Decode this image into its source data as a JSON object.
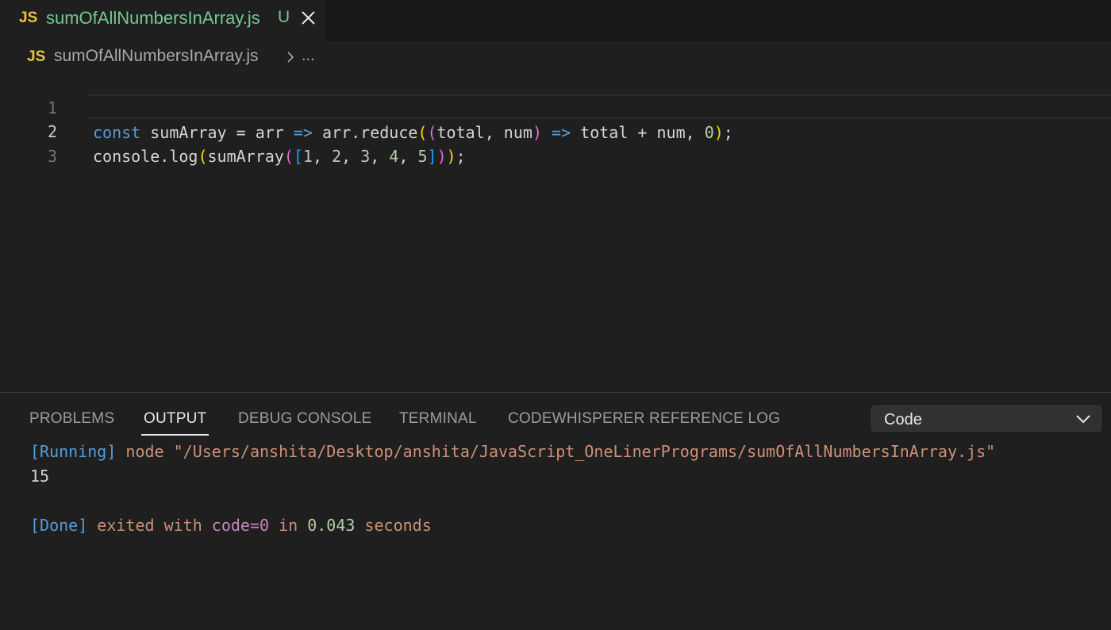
{
  "tab": {
    "lang_badge": "JS",
    "filename": "sumOfAllNumbersInArray.js",
    "status": "U",
    "close_icon": "close-icon"
  },
  "breadcrumb": {
    "lang_badge": "JS",
    "filename": "sumOfAllNumbersInArray.js",
    "separator_icon": "chevron-right-icon",
    "more": "..."
  },
  "editor": {
    "lines": [
      {
        "number": "1",
        "tokens": [
          "const",
          " sumArray = arr ",
          "=>",
          " arr.reduce",
          "(",
          "(",
          "total, num",
          ")",
          " ",
          "=>",
          " total + num, ",
          "0",
          ")",
          ";"
        ]
      },
      {
        "number": "2",
        "tokens": [
          "console.log",
          "(",
          "sumArray",
          "(",
          "[",
          "1",
          ", ",
          "2",
          ", ",
          "3",
          ", ",
          "4",
          ", ",
          "5",
          "]",
          ")",
          ")",
          ";"
        ]
      },
      {
        "number": "3",
        "tokens": []
      }
    ]
  },
  "panel": {
    "tabs": [
      "PROBLEMS",
      "OUTPUT",
      "DEBUG CONSOLE",
      "TERMINAL",
      "CODEWHISPERER REFERENCE LOG"
    ],
    "active_tab": "OUTPUT",
    "channel_select": "Code",
    "output": {
      "running_tag": "[Running]",
      "running_cmd": " node \"/Users/anshita/Desktop/anshita/JavaScript_OneLinerPrograms/sumOfAllNumbersInArray.js\"",
      "result": "15",
      "done_tag": "[Done]",
      "done_exited": " exited with ",
      "done_code": "code=0",
      "done_in": " in ",
      "done_time": "0.043",
      "done_seconds": " seconds"
    }
  },
  "colors": {
    "background": "#1f1f1f",
    "tab_text": "#73c991",
    "js_badge": "#e8c63b",
    "keyword": "#569cd6",
    "number": "#b5cea8",
    "string": "#ce9178"
  }
}
